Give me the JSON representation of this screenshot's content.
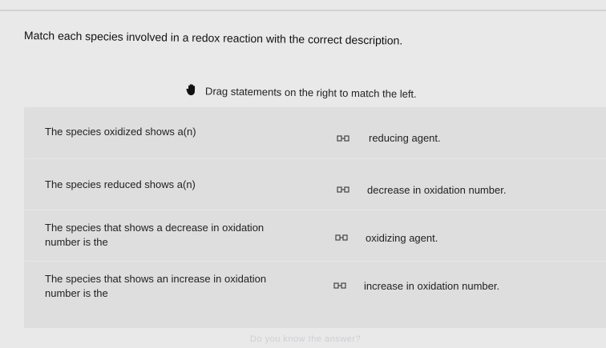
{
  "question": {
    "title": "Match each species involved in a redox reaction with the correct description.",
    "hint": "Drag statements on the right to match the left."
  },
  "rows": [
    {
      "left": "The species oxidized shows a(n)",
      "right": "reducing agent."
    },
    {
      "left": "The species reduced shows a(n)",
      "right": "decrease in oxidation number."
    },
    {
      "left": "The species that shows a decrease in oxidation number is the",
      "right": "oxidizing agent."
    },
    {
      "left": "The species that shows an increase in oxidation number is the",
      "right": "increase in oxidation number."
    }
  ],
  "footer": {
    "text": "Do you know the answer?"
  },
  "icons": {
    "hint": "hand-icon",
    "handle": "drag-handle-icon"
  },
  "colors": {
    "background": "#e9e9ea",
    "panel": "#dededf",
    "text": "#1c1c1c"
  }
}
